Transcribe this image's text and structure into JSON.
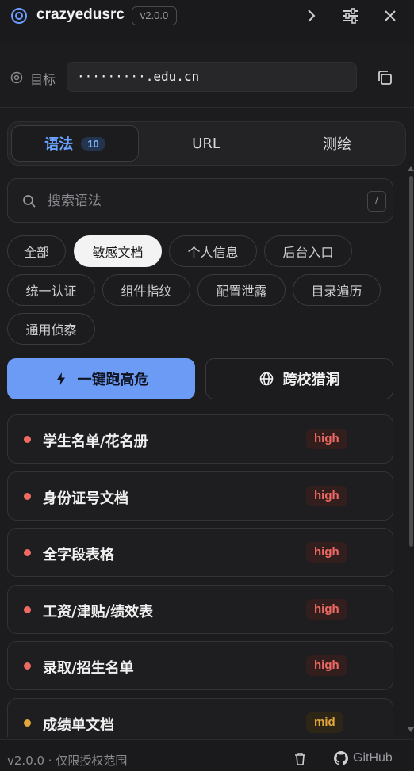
{
  "header": {
    "title": "crazyedusrc",
    "version_badge": "v2.0.0",
    "icons": [
      "target-logo-icon",
      "chevron-right-icon",
      "sliders-icon",
      "close-icon"
    ]
  },
  "target": {
    "label": "目标",
    "value": "·········.edu.cn"
  },
  "tabs": [
    {
      "label": "语法",
      "count": "10",
      "active": true
    },
    {
      "label": "URL"
    },
    {
      "label": "测绘"
    }
  ],
  "search": {
    "placeholder": "搜索语法",
    "shortcut": "/"
  },
  "chips": [
    "全部",
    "敏感文档",
    "个人信息",
    "后台入口",
    "统一认证",
    "组件指纹",
    "配置泄露",
    "目录遍历",
    "通用侦察"
  ],
  "active_chip": "敏感文档",
  "actions": {
    "primary": "一键跑高危",
    "secondary": "跨校猎洞"
  },
  "items": [
    {
      "title": "学生名单/花名册",
      "level": "high"
    },
    {
      "title": "身份证号文档",
      "level": "high"
    },
    {
      "title": "全字段表格",
      "level": "high"
    },
    {
      "title": "工资/津贴/绩效表",
      "level": "high"
    },
    {
      "title": "录取/招生名单",
      "level": "high"
    },
    {
      "title": "成绩单文档",
      "level": "mid"
    }
  ],
  "colors": {
    "accent": "#6b9bf5",
    "high": "#ef6a63",
    "mid": "#e3a63d",
    "background": "#1c1c1e"
  },
  "footer": {
    "text": "v2.0.0 · 仅限授权范围",
    "github": "GitHub"
  }
}
